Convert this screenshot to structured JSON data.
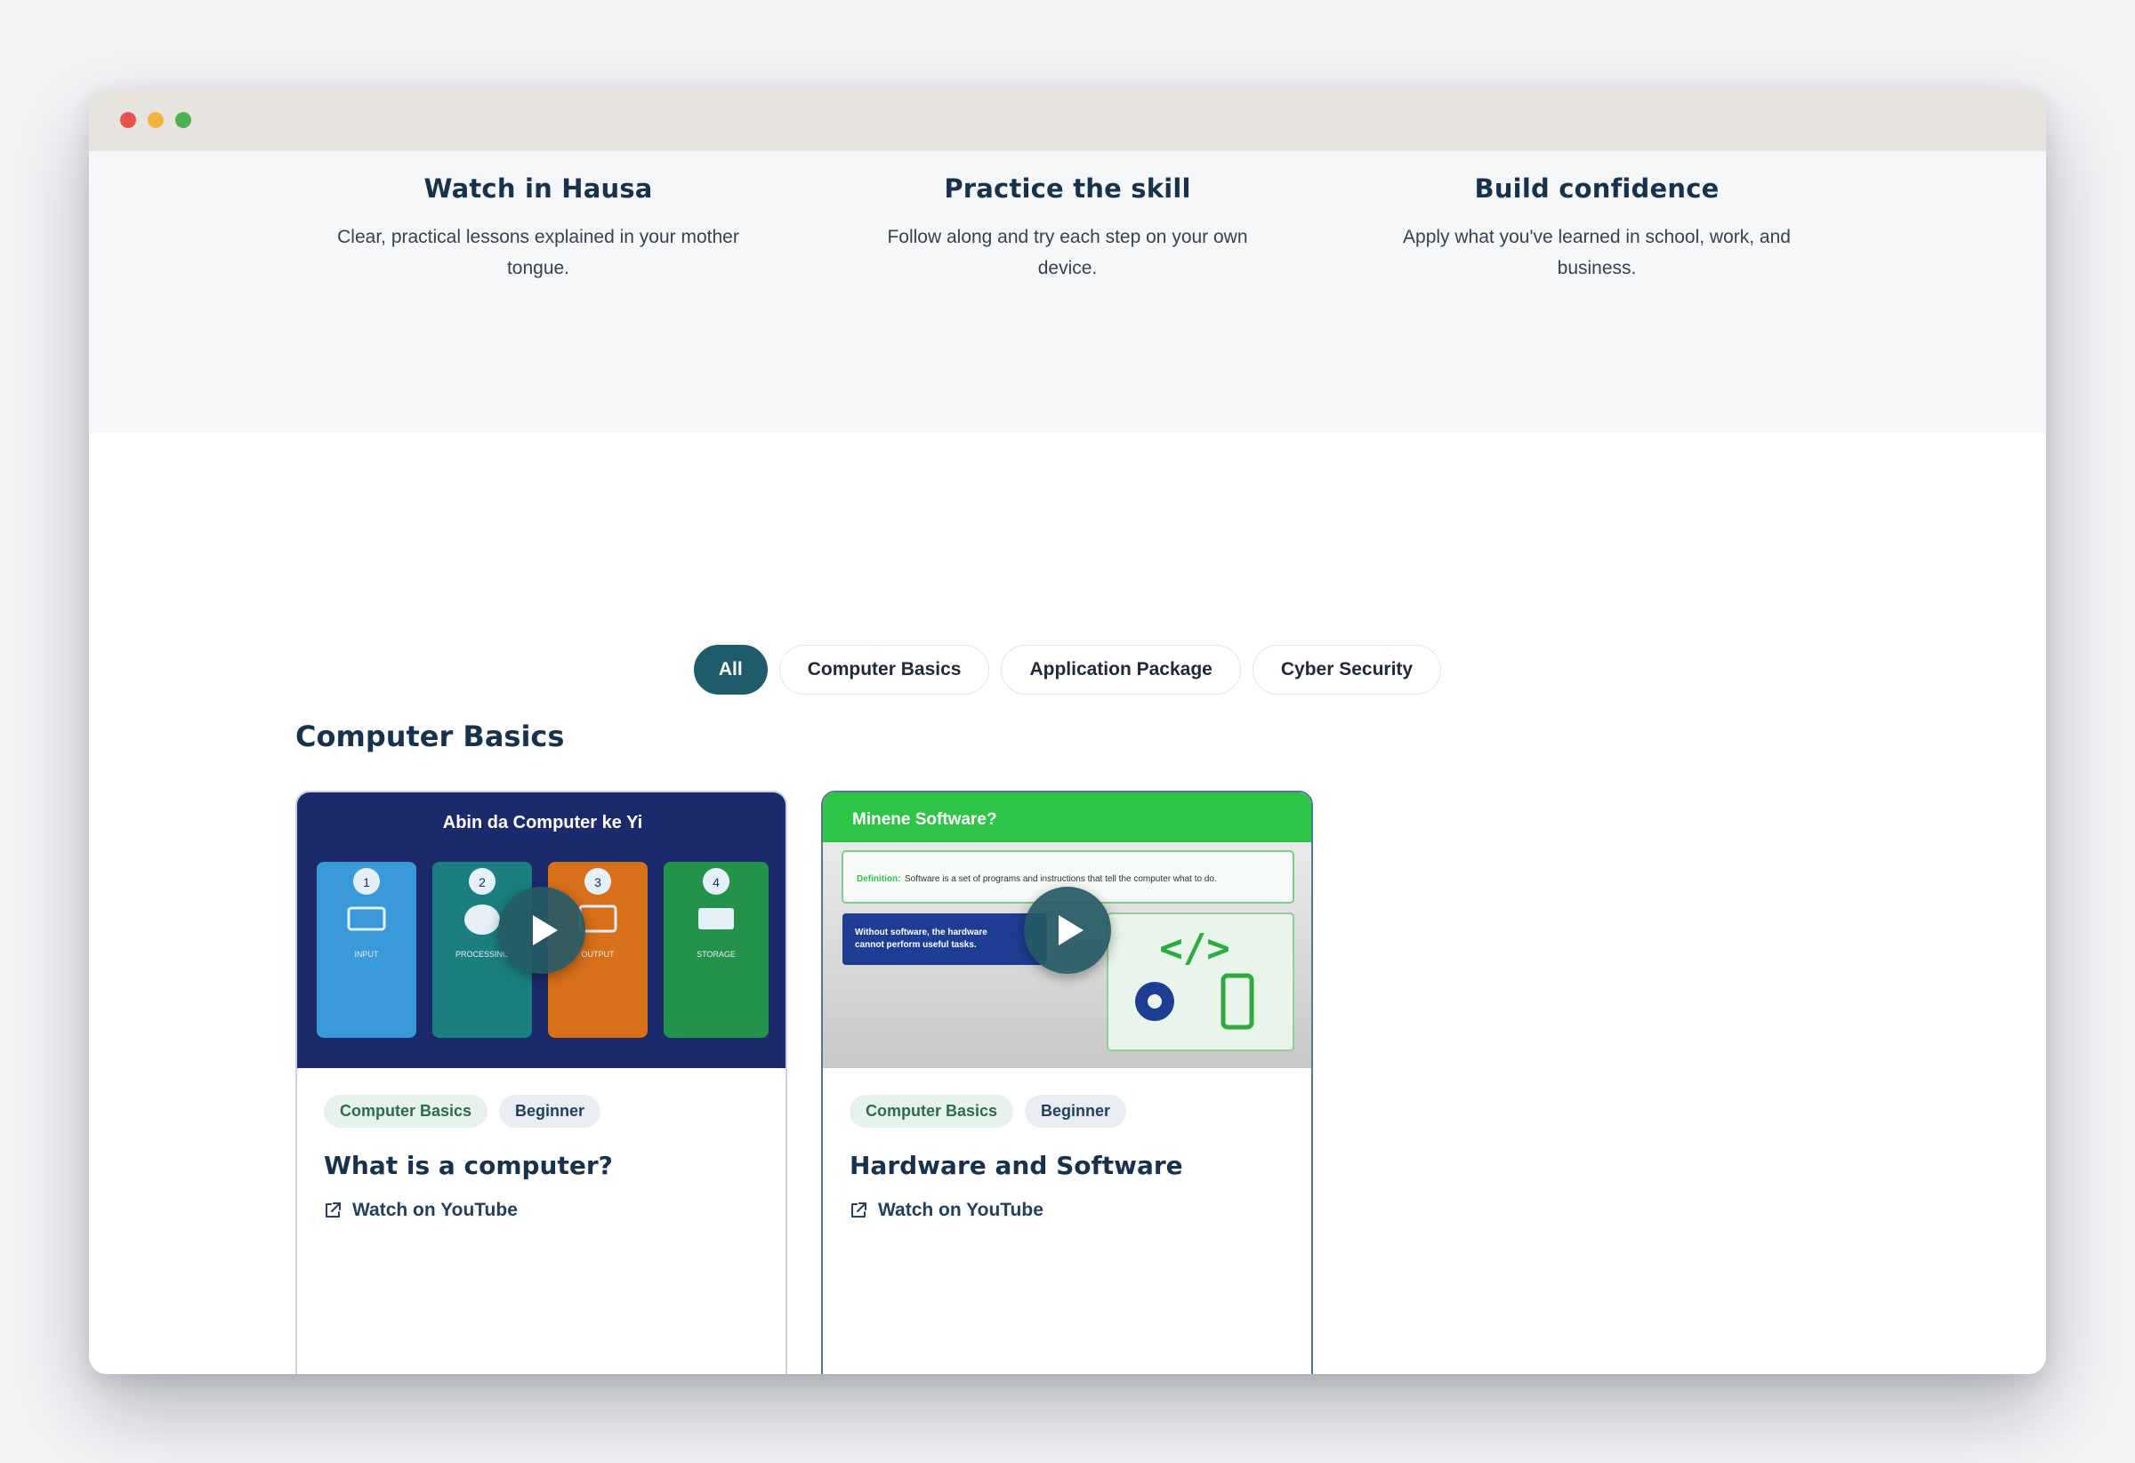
{
  "features": [
    {
      "title": "Watch in Hausa",
      "description": "Clear, practical lessons explained in your mother tongue."
    },
    {
      "title": "Practice the skill",
      "description": "Follow along and try each step on your own device."
    },
    {
      "title": "Build confidence",
      "description": "Apply what you've learned in school, work, and business."
    }
  ],
  "filters": {
    "items": [
      {
        "label": "All",
        "active": true
      },
      {
        "label": "Computer Basics",
        "active": false
      },
      {
        "label": "Application Package",
        "active": false
      },
      {
        "label": "Cyber Security",
        "active": false
      }
    ]
  },
  "section": {
    "title": "Computer Basics"
  },
  "cards": [
    {
      "thumbnail": {
        "heading": "Abin da Computer ke Yi",
        "steps": [
          {
            "num": "1",
            "label": "INPUT"
          },
          {
            "num": "2",
            "label": "PROCESSING"
          },
          {
            "num": "3",
            "label": "OUTPUT"
          },
          {
            "num": "4",
            "label": "STORAGE"
          }
        ]
      },
      "category": "Computer Basics",
      "level": "Beginner",
      "title": "What is a computer?",
      "link_label": "Watch on YouTube"
    },
    {
      "thumbnail": {
        "heading": "Minene Software?",
        "definition_label": "Definition:",
        "definition_text": "Software is a set of programs and instructions that tell the computer what to do.",
        "note_line1": "Without software, the hardware",
        "note_line2": "cannot perform useful tasks."
      },
      "category": "Computer Basics",
      "level": "Beginner",
      "title": "Hardware and Software",
      "link_label": "Watch on YouTube"
    }
  ],
  "colors": {
    "accent": "#1f5c6b",
    "heading": "#17324d",
    "titlebar": "#e7e4df"
  }
}
